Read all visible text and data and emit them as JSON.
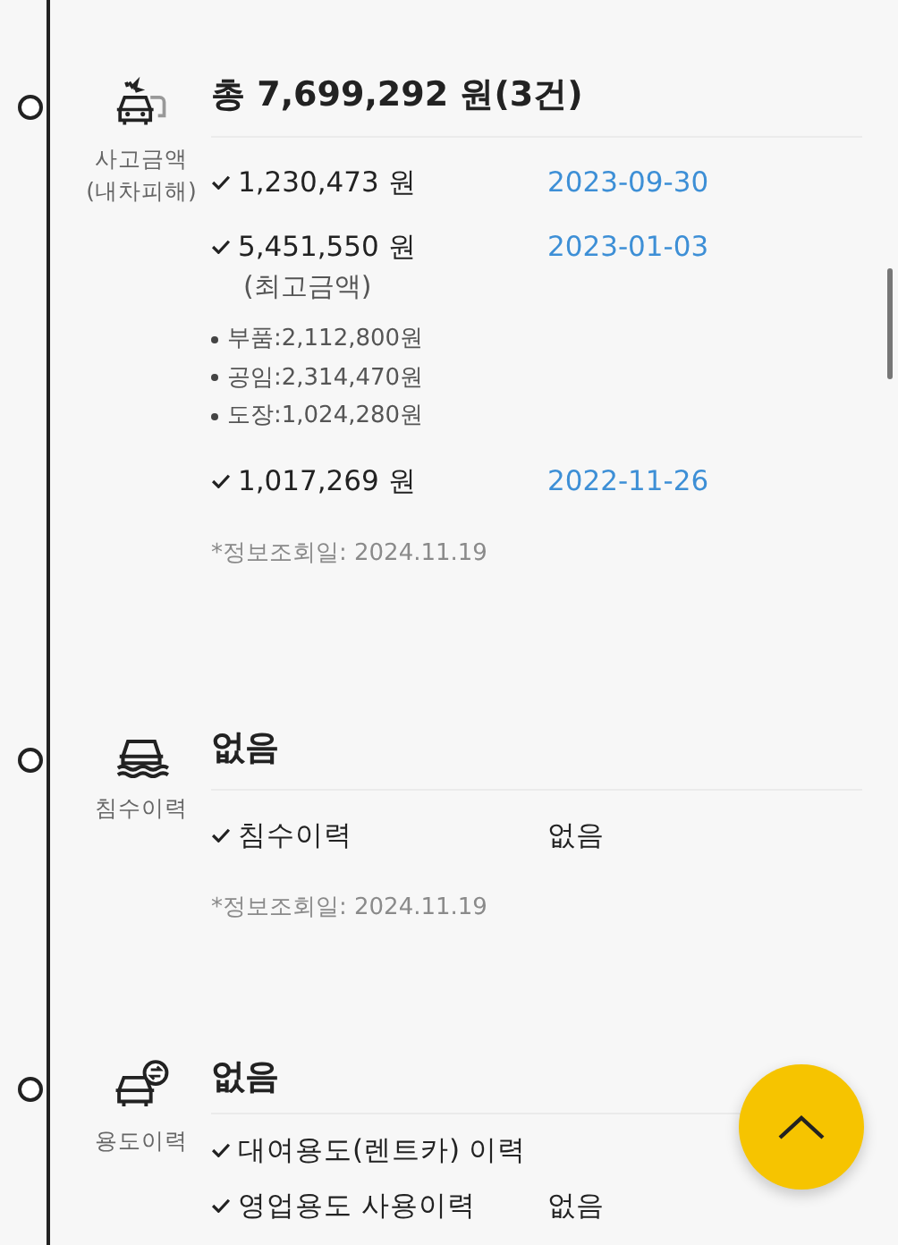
{
  "sections": [
    {
      "kind": "accident",
      "label": [
        "사고금액",
        "(내차피해)"
      ],
      "title": "총 7,699,292 원(3건)",
      "rows": [
        {
          "label": "1,230,473 원",
          "value": "2023-09-30",
          "kind": "date"
        },
        {
          "label": "5,451,550 원",
          "note": "(최고금액)",
          "value": "2023-01-03",
          "kind": "date",
          "details": [
            "부품:2,112,800원",
            "공임:2,314,470원",
            "도장:1,024,280원"
          ]
        },
        {
          "label": "1,017,269 원",
          "value": "2022-11-26",
          "kind": "date"
        }
      ],
      "info": "*정보조회일: 2024.11.19"
    },
    {
      "kind": "flood",
      "label": [
        "침수이력"
      ],
      "title": "없음",
      "rows": [
        {
          "label": "침수이력",
          "value": "없음",
          "kind": "plain"
        }
      ],
      "info": "*정보조회일: 2024.11.19"
    },
    {
      "kind": "usage",
      "label": [
        "용도이력"
      ],
      "title": "없음",
      "rows": [
        {
          "label": "대여용도(렌트카) 이력"
        },
        {
          "label": "영업용도 사용이력",
          "value": "없음",
          "kind": "plain"
        }
      ]
    }
  ]
}
